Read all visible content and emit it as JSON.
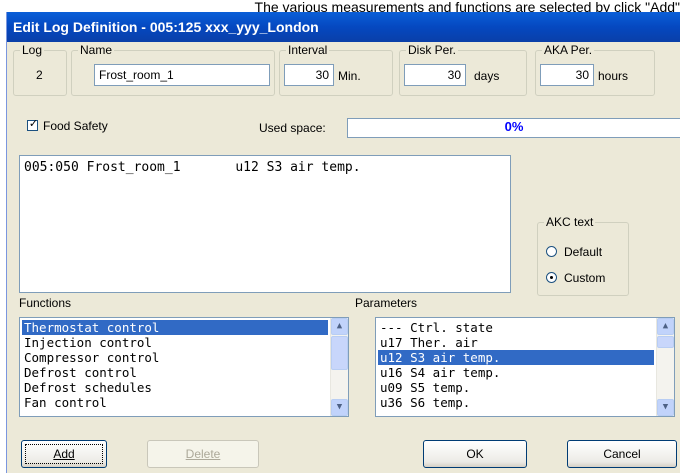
{
  "caption": "The various measurements and functions are selected by click \"Add\"",
  "window": {
    "title": "Edit Log Definition - 005:125  xxx_yyy_London"
  },
  "log": {
    "label": "Log",
    "value": "2"
  },
  "name": {
    "label": "Name",
    "value": "Frost_room_1"
  },
  "interval": {
    "label": "Interval",
    "value": "30",
    "unit": "Min."
  },
  "disk_per": {
    "label": "Disk Per.",
    "value": "30",
    "unit": "days"
  },
  "aka_per": {
    "label": "AKA Per.",
    "value": "30",
    "unit": "hours"
  },
  "food_safety": {
    "label": "Food Safety",
    "checked": true,
    "mark": "✓"
  },
  "used_space": {
    "label": "Used space:",
    "text": "0%",
    "percent": 0
  },
  "log_entries": [
    {
      "text": "005:050 Frost_room_1       u12 S3 air temp."
    }
  ],
  "akc_text": {
    "label": "AKC text",
    "options": [
      {
        "label": "Default",
        "selected": false
      },
      {
        "label": "Custom",
        "selected": true
      }
    ]
  },
  "functions": {
    "label": "Functions",
    "items": [
      {
        "text": "Thermostat control",
        "selected": true
      },
      {
        "text": "Injection control",
        "selected": false
      },
      {
        "text": "Compressor control",
        "selected": false
      },
      {
        "text": "Defrost control",
        "selected": false
      },
      {
        "text": "Defrost schedules",
        "selected": false
      },
      {
        "text": "Fan control",
        "selected": false
      }
    ]
  },
  "parameters": {
    "label": "Parameters",
    "items": [
      {
        "text": "--- Ctrl. state",
        "selected": false
      },
      {
        "text": "u17 Ther. air",
        "selected": false
      },
      {
        "text": "u12 S3 air temp.",
        "selected": true
      },
      {
        "text": "u16 S4 air temp.",
        "selected": false
      },
      {
        "text": "u09 S5 temp.",
        "selected": false
      },
      {
        "text": "u36 S6 temp.",
        "selected": false
      }
    ]
  },
  "scroll_glyphs": {
    "up": "▲",
    "down": "▼"
  },
  "buttons": {
    "add": {
      "label": "Add",
      "enabled": true
    },
    "delete": {
      "label": "Delete",
      "enabled": false
    },
    "ok": {
      "label": "OK",
      "enabled": true
    },
    "cancel": {
      "label": "Cancel",
      "enabled": true
    }
  }
}
